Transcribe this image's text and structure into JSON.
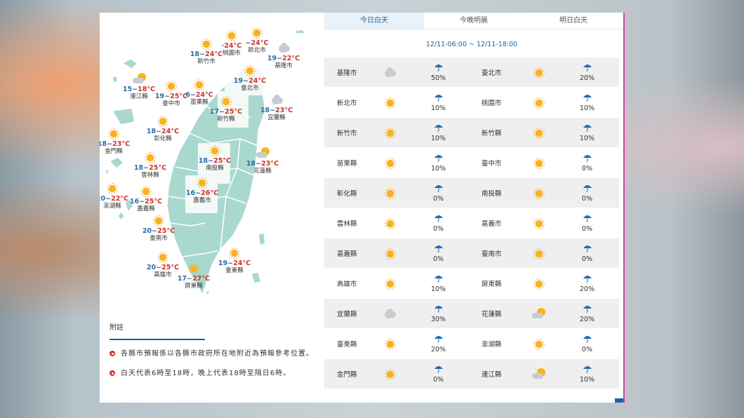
{
  "tabs": [
    "今日白天",
    "今晚明晨",
    "明日白天"
  ],
  "period": "12/11-06:00 ~ 12/11-18:00",
  "colors": {
    "accent": "#2a5f8f",
    "high_temp": "#d0332c",
    "low_temp": "#2d6aa8",
    "land": "#a9d8cf"
  },
  "map_cities": [
    {
      "name": "新竹市",
      "temp_lo": "18",
      "temp_hi": "24°C",
      "icon": "sun-icon"
    },
    {
      "name": "桃園市",
      "temp_lo": "",
      "temp_hi": "24°C",
      "temp_prefix": "·",
      "icon": "sun-icon"
    },
    {
      "name": "新北市",
      "temp_lo": "",
      "temp_hi": "24°C",
      "temp_prefix": "~",
      "icon": "sun-icon"
    },
    {
      "name": "基隆市",
      "temp_lo": "19",
      "temp_hi": "22°C",
      "icon": "rain-cloud-icon"
    },
    {
      "name": "連江縣",
      "temp_lo": "15",
      "temp_hi": "18°C",
      "icon": "partly-cloudy-icon"
    },
    {
      "name": "臺中市",
      "temp_lo": "19",
      "temp_hi": "25°C",
      "icon": "sun-icon"
    },
    {
      "name": "苗栗縣",
      "temp_lo": "6",
      "temp_hi": "24°C",
      "icon": "sun-icon"
    },
    {
      "name": "臺北市",
      "temp_lo": "19",
      "temp_hi": "24°C",
      "icon": "sun-icon"
    },
    {
      "name": "新竹縣",
      "temp_lo": "17",
      "temp_hi": "25°C",
      "icon": "sun-icon"
    },
    {
      "name": "宜蘭縣",
      "temp_lo": "18",
      "temp_hi": "23°C",
      "icon": "rain-cloud-icon"
    },
    {
      "name": "彰化縣",
      "temp_lo": "18",
      "temp_hi": "24°C",
      "icon": "sun-icon"
    },
    {
      "name": "金門縣",
      "temp_lo": "18",
      "temp_hi": "23°C",
      "icon": "sun-icon"
    },
    {
      "name": "南投縣",
      "temp_lo": "18",
      "temp_hi": "25°C",
      "icon": "sun-icon"
    },
    {
      "name": "花蓮縣",
      "temp_lo": "18",
      "temp_hi": "23°C",
      "icon": "partly-cloudy-icon"
    },
    {
      "name": "雲林縣",
      "temp_lo": "18",
      "temp_hi": "25°C",
      "icon": "sun-icon"
    },
    {
      "name": "澎湖縣",
      "temp_lo": "20",
      "temp_hi": "22°C",
      "icon": "sun-icon"
    },
    {
      "name": "嘉義縣",
      "temp_lo": "16",
      "temp_hi": "25°C",
      "icon": "sun-icon"
    },
    {
      "name": "嘉義市",
      "temp_lo": "16",
      "temp_hi": "26°C",
      "icon": "sun-icon"
    },
    {
      "name": "臺南市",
      "temp_lo": "20",
      "temp_hi": "25°C",
      "icon": "sun-icon"
    },
    {
      "name": "高雄市",
      "temp_lo": "20",
      "temp_hi": "25°C",
      "icon": "sun-icon"
    },
    {
      "name": "屏東縣",
      "temp_lo": "17",
      "temp_hi": "27°C",
      "icon": "sun-icon"
    },
    {
      "name": "臺東縣",
      "temp_lo": "19",
      "temp_hi": "24°C",
      "icon": "sun-icon"
    }
  ],
  "notes": {
    "title": "附註",
    "items": [
      "各縣市預報係以各縣市政府所在地附近為預報參考位置。",
      "白天代表6時至18時，晚上代表18時至隔日6時。"
    ]
  },
  "table": [
    [
      {
        "name": "基隆市",
        "icon": "rain-cloud-icon",
        "pop": "50%"
      },
      {
        "name": "臺北市",
        "icon": "sun-icon",
        "pop": "20%"
      }
    ],
    [
      {
        "name": "新北市",
        "icon": "sun-icon",
        "pop": "10%"
      },
      {
        "name": "桃園市",
        "icon": "sun-icon",
        "pop": "10%"
      }
    ],
    [
      {
        "name": "新竹市",
        "icon": "sun-icon",
        "pop": "10%"
      },
      {
        "name": "新竹縣",
        "icon": "sun-icon",
        "pop": "10%"
      }
    ],
    [
      {
        "name": "苗栗縣",
        "icon": "sun-icon",
        "pop": "10%"
      },
      {
        "name": "臺中市",
        "icon": "sun-icon",
        "pop": "0%"
      }
    ],
    [
      {
        "name": "彰化縣",
        "icon": "sun-icon",
        "pop": "0%"
      },
      {
        "name": "南投縣",
        "icon": "sun-icon",
        "pop": "0%"
      }
    ],
    [
      {
        "name": "雲林縣",
        "icon": "sun-icon",
        "pop": "0%"
      },
      {
        "name": "嘉義市",
        "icon": "sun-icon",
        "pop": "0%"
      }
    ],
    [
      {
        "name": "嘉義縣",
        "icon": "sun-icon",
        "pop": "0%"
      },
      {
        "name": "臺南市",
        "icon": "sun-icon",
        "pop": "0%"
      }
    ],
    [
      {
        "name": "高雄市",
        "icon": "sun-icon",
        "pop": "10%"
      },
      {
        "name": "屏東縣",
        "icon": "sun-icon",
        "pop": "20%"
      }
    ],
    [
      {
        "name": "宜蘭縣",
        "icon": "rain-cloud-icon",
        "pop": "30%"
      },
      {
        "name": "花蓮縣",
        "icon": "partly-cloudy-icon",
        "pop": "20%"
      }
    ],
    [
      {
        "name": "臺東縣",
        "icon": "sun-icon",
        "pop": "20%"
      },
      {
        "name": "澎湖縣",
        "icon": "sun-icon",
        "pop": "0%"
      }
    ],
    [
      {
        "name": "金門縣",
        "icon": "sun-icon",
        "pop": "0%"
      },
      {
        "name": "連江縣",
        "icon": "partly-cloudy-icon",
        "pop": "10%"
      }
    ]
  ]
}
